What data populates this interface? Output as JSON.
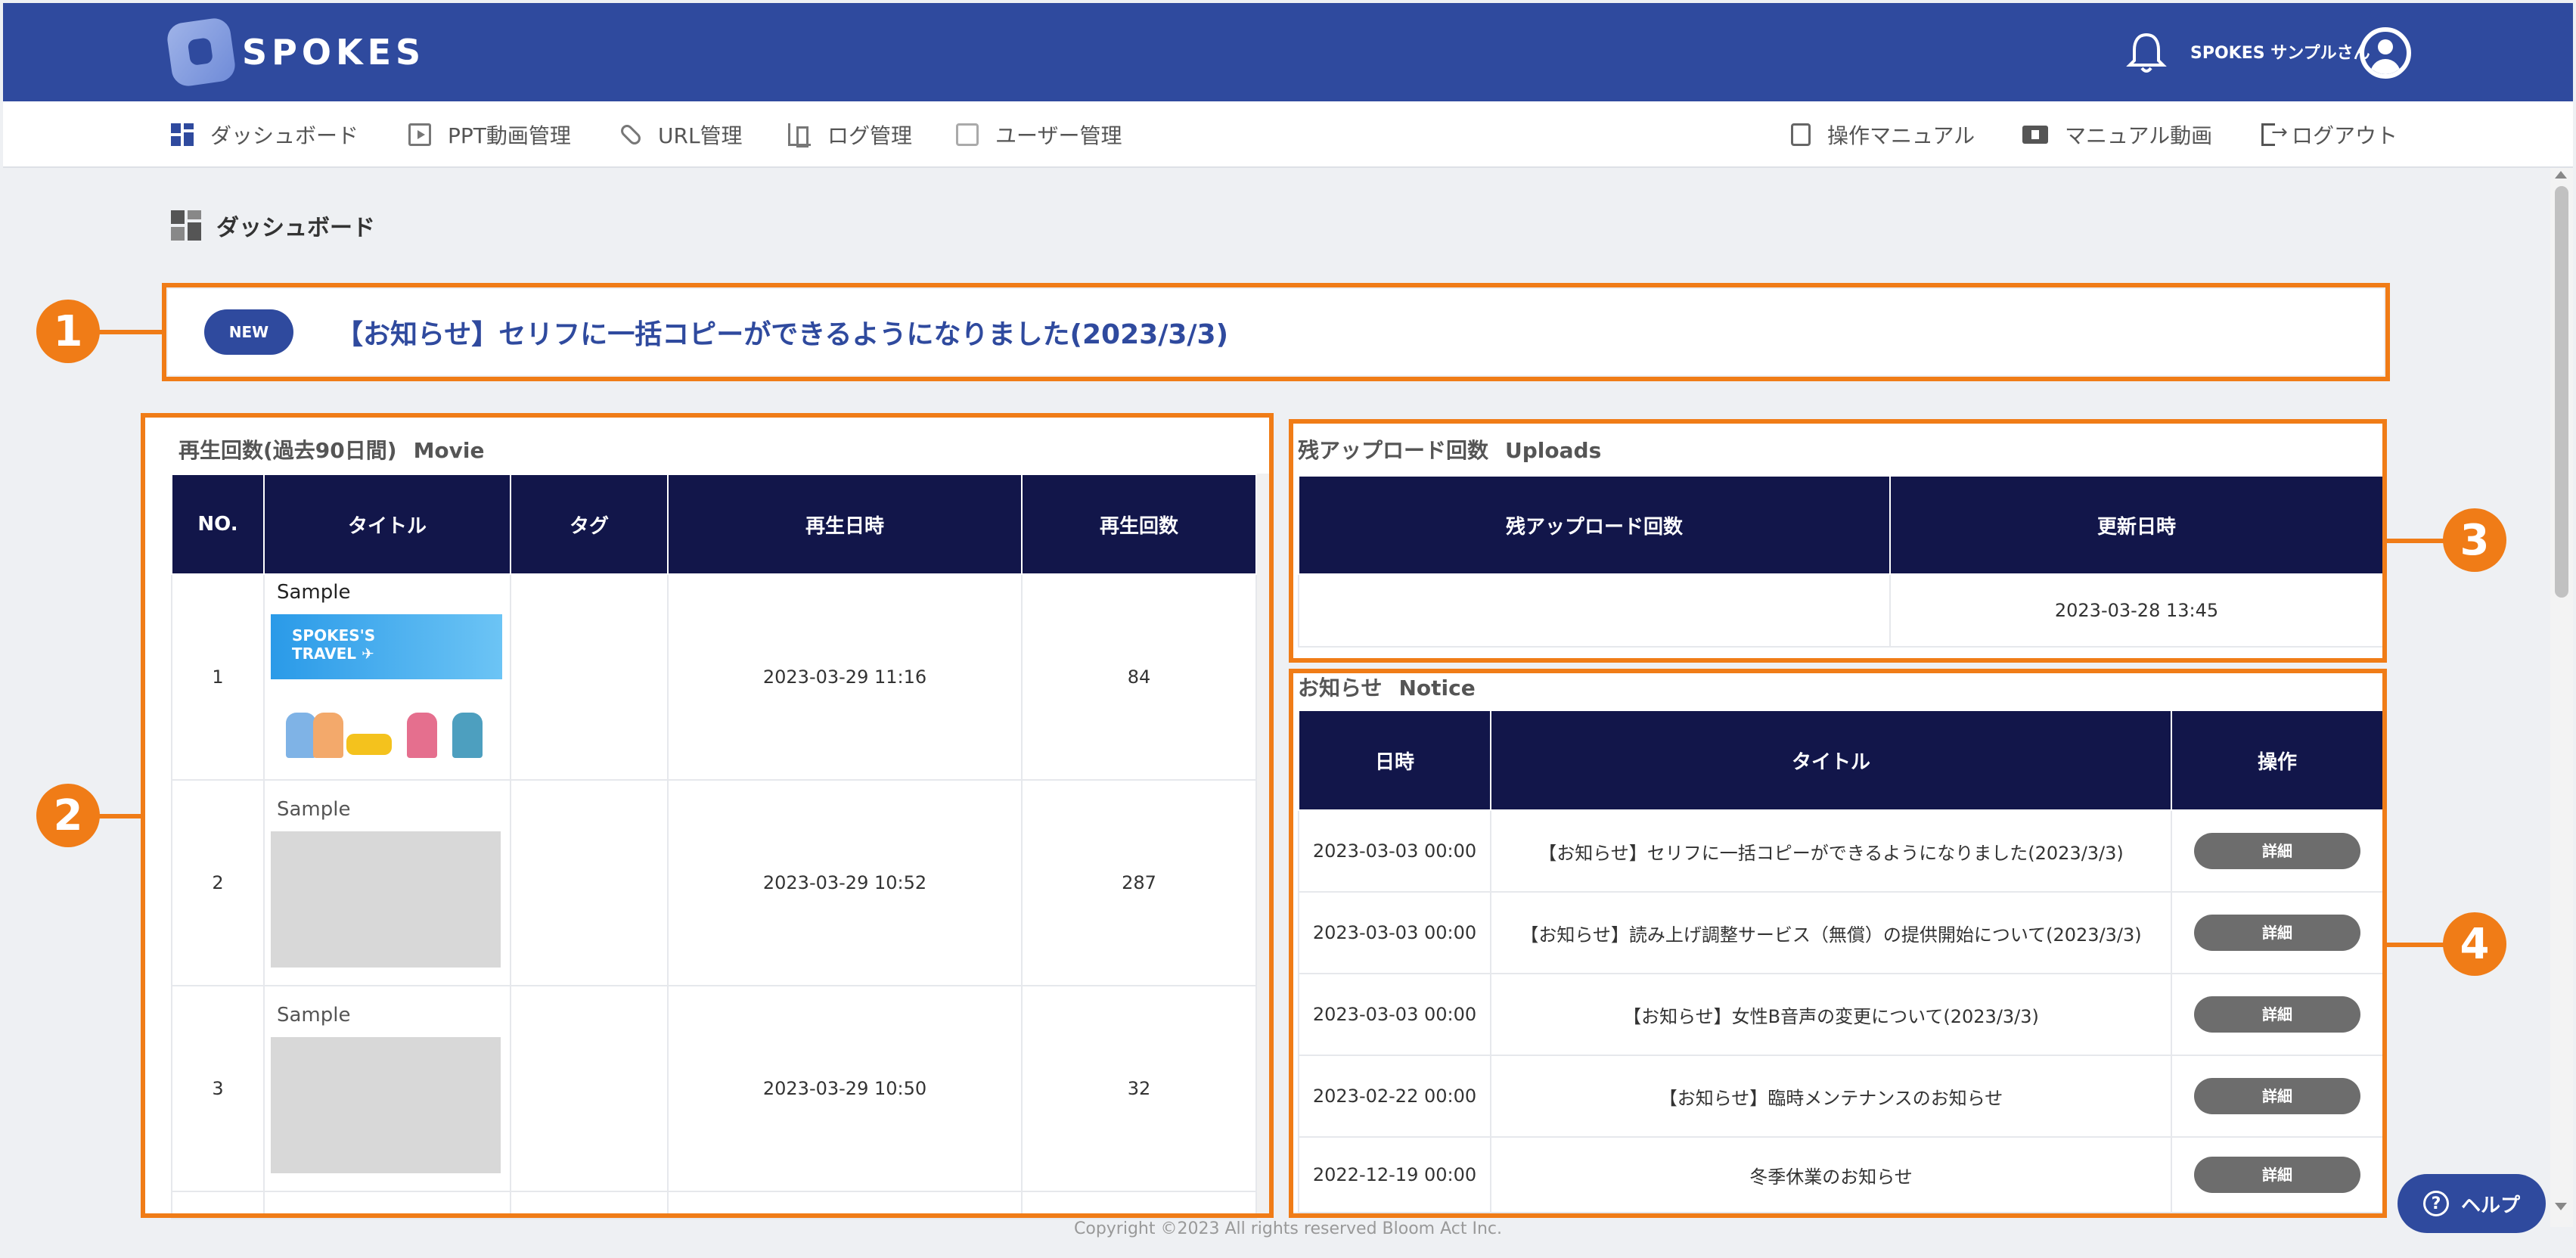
{
  "header": {
    "logo_text": "SPOKES",
    "user_name": "SPOKES サンプルさん"
  },
  "nav": {
    "left": [
      {
        "label": "ダッシュボード",
        "icon": "dashboard-icon"
      },
      {
        "label": "PPT動画管理",
        "icon": "ppt-video-icon"
      },
      {
        "label": "URL管理",
        "icon": "link-icon"
      },
      {
        "label": "ログ管理",
        "icon": "log-icon"
      },
      {
        "label": "ユーザー管理",
        "icon": "user-manage-icon"
      }
    ],
    "right": [
      {
        "label": "操作マニュアル",
        "icon": "manual-icon"
      },
      {
        "label": "マニュアル動画",
        "icon": "video-icon"
      },
      {
        "label": "ログアウト",
        "icon": "logout-icon"
      }
    ]
  },
  "page": {
    "title": "ダッシュボード"
  },
  "callouts": [
    "1",
    "2",
    "3",
    "4"
  ],
  "announcement": {
    "badge": "NEW",
    "text": "【お知らせ】セリフに一括コピーができるようになりました(2023/3/3)"
  },
  "movie": {
    "label": "再生回数(過去90日間)",
    "label_en": "Movie",
    "headers": [
      "NO.",
      "タイトル",
      "タグ",
      "再生日時",
      "再生回数"
    ],
    "rows": [
      {
        "no": "1",
        "title": "Sample",
        "tag": "",
        "date": "2023-03-29 11:16",
        "count": "84"
      },
      {
        "no": "2",
        "title": "Sample",
        "tag": "",
        "date": "2023-03-29 10:52",
        "count": "287"
      },
      {
        "no": "3",
        "title": "Sample",
        "tag": "",
        "date": "2023-03-29 10:50",
        "count": "32"
      }
    ],
    "thumb_text_line1": "SPOKES'S",
    "thumb_text_line2": "TRAVEL"
  },
  "uploads": {
    "label": "残アップロード回数",
    "label_en": "Uploads",
    "headers": [
      "残アップロード回数",
      "更新日時"
    ],
    "row": {
      "remaining": "",
      "updated": "2023-03-28 13:45"
    }
  },
  "notice": {
    "label": "お知らせ",
    "label_en": "Notice",
    "headers": [
      "日時",
      "タイトル",
      "操作"
    ],
    "detail_label": "詳細",
    "rows": [
      {
        "date": "2023-03-03 00:00",
        "title": "【お知らせ】セリフに一括コピーができるようになりました(2023/3/3)"
      },
      {
        "date": "2023-03-03 00:00",
        "title": "【お知らせ】読み上げ調整サービス（無償）の提供開始について(2023/3/3)"
      },
      {
        "date": "2023-03-03 00:00",
        "title": "【お知らせ】女性B音声の変更について(2023/3/3)"
      },
      {
        "date": "2023-02-22 00:00",
        "title": "【お知らせ】臨時メンテナンスのお知らせ"
      },
      {
        "date": "2022-12-19 00:00",
        "title": "冬季休業のお知らせ"
      }
    ]
  },
  "footer": "Copyright ©2023 All rights reserved Bloom Act Inc.",
  "help_label": "ヘルプ",
  "colors": {
    "header_bg": "#2f4a9e",
    "table_header_bg": "#12164a",
    "highlight_orange": "#f07c17"
  }
}
